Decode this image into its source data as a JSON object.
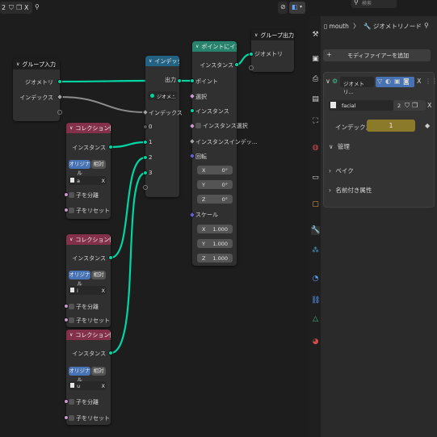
{
  "node_editor": {
    "topbar": {
      "slot_number": "2",
      "close_glyph": "X"
    },
    "group_input": {
      "title": "グループ入力",
      "outputs": [
        "ジオメトリ",
        "インデックス"
      ]
    },
    "collection_info_nodes": [
      {
        "title": "コレクション情報",
        "output": "インスタンス",
        "toggle_original": "オリジナル",
        "toggle_relative": "相対",
        "collection": "a",
        "clear": "X",
        "separate_children": "子を分離",
        "reset_children": "子をリセット"
      },
      {
        "title": "コレクション情報",
        "output": "インスタンス",
        "toggle_original": "オリジナル",
        "toggle_relative": "相対",
        "collection": "i",
        "clear": "X",
        "separate_children": "子を分離",
        "reset_children": "子をリセット"
      },
      {
        "title": "コレクション情報",
        "output": "インスタンス",
        "toggle_original": "オリジナル",
        "toggle_relative": "相対",
        "collection": "u",
        "clear": "X",
        "separate_children": "子を分離",
        "reset_children": "子をリセット"
      }
    ],
    "index_switch": {
      "title": "インデックス...",
      "output": "出力",
      "dropdown": "ジオメ...",
      "index_label": "インデックス",
      "items": [
        "0",
        "1",
        "2",
        "3"
      ]
    },
    "instance_on_points": {
      "title": "ポイントにインスタ...",
      "output": "インスタンス",
      "inputs": {
        "points": "ポイント",
        "selection": "選択",
        "instance": "インスタンス",
        "pick_instance": "インスタンス選択",
        "instance_index": "インスタンスインデッ...",
        "rotation": "回転",
        "scale": "スケール"
      },
      "rotation": [
        {
          "axis": "X",
          "value": "0°"
        },
        {
          "axis": "Y",
          "value": "0°"
        },
        {
          "axis": "Z",
          "value": "0°"
        }
      ],
      "scale": [
        {
          "axis": "X",
          "value": "1.000"
        },
        {
          "axis": "Y",
          "value": "1.000"
        },
        {
          "axis": "Z",
          "value": "1.000"
        }
      ]
    },
    "group_output": {
      "title": "グループ出力",
      "input": "ジオメトリ"
    }
  },
  "properties": {
    "search_placeholder": "検索",
    "breadcrumb": {
      "object": "mouth",
      "separator": "〉",
      "modifier": "ジオメトリノード"
    },
    "add_modifier": "モディファイアーを追加",
    "modifier": {
      "name": "ジオメトリ...",
      "close": "X",
      "node_group": "facial",
      "user_count": "2",
      "index_label": "インデックス",
      "index_value": "1",
      "panels": [
        "管理",
        "ベイク",
        "名前付き属性"
      ]
    }
  },
  "colors": {
    "geometry_socket": "#00d6a3",
    "group_header": "#1d1d1d",
    "input_header": "#83314a",
    "index_switch_header": "#246283",
    "instance_header": "#27836b",
    "accent_blue": "#4772b3",
    "index_field": "#8a7a2a"
  }
}
